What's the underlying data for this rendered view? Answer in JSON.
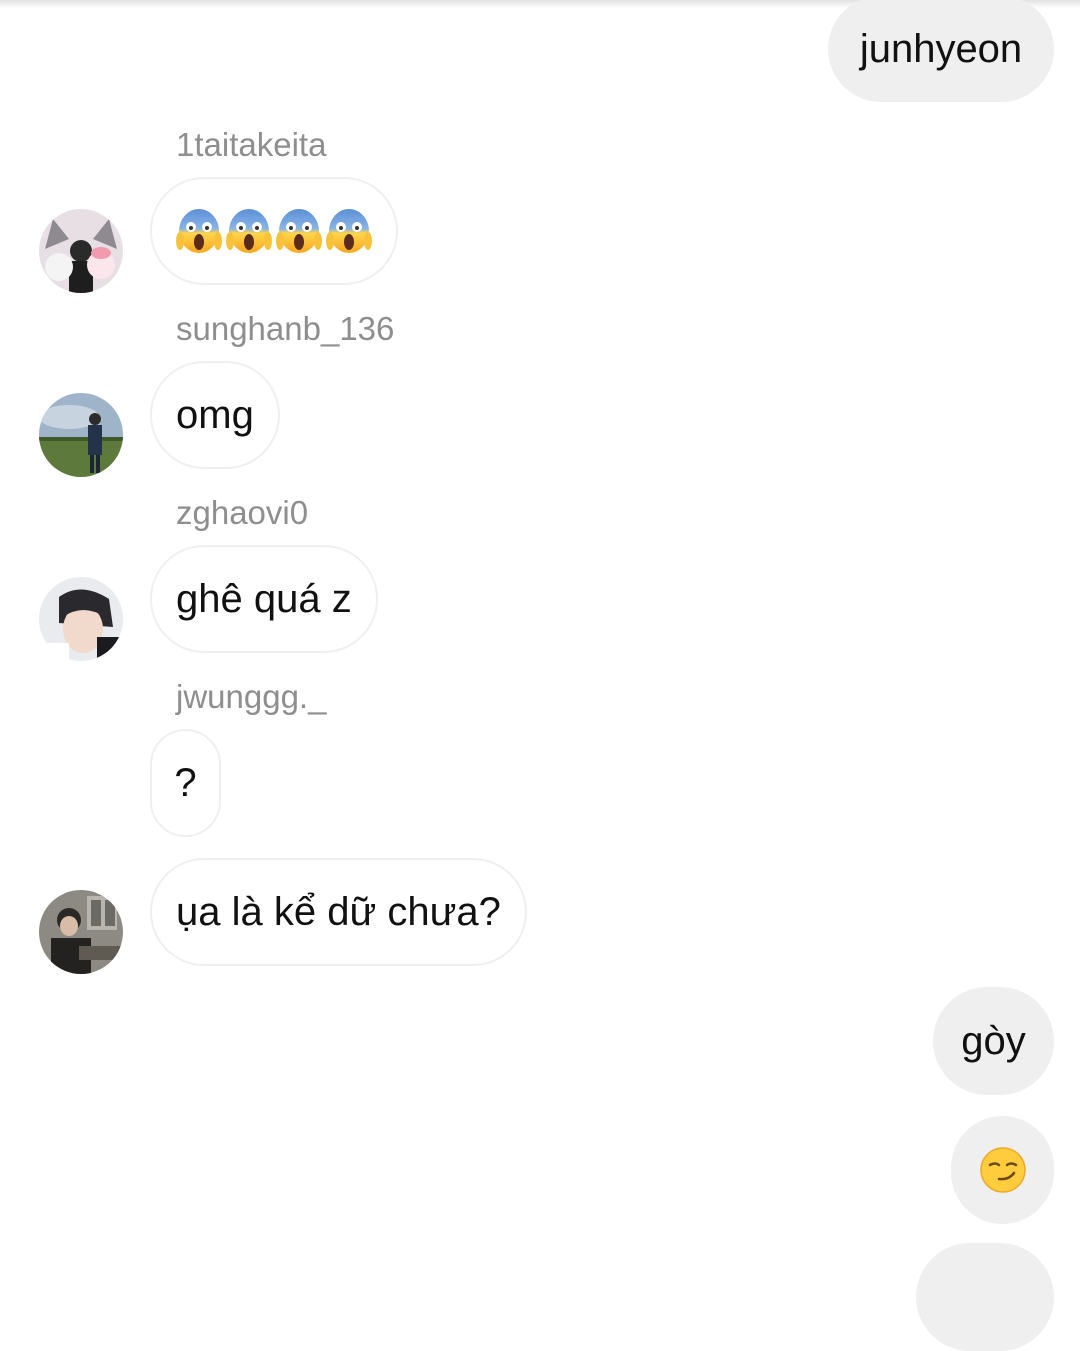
{
  "messages": [
    {
      "side": "out",
      "text": "junhyeon"
    },
    {
      "side": "in",
      "sender": "1taitakeita",
      "emoji": [
        "face-screaming-in-fear",
        "face-screaming-in-fear",
        "face-screaming-in-fear",
        "face-screaming-in-fear"
      ]
    },
    {
      "side": "in",
      "sender": "sunghanb_136",
      "text": "omg"
    },
    {
      "side": "in",
      "sender": "zghaovi0",
      "text": "ghê quá z"
    },
    {
      "side": "in",
      "sender": "jwunggg._",
      "text": "?"
    },
    {
      "side": "in",
      "text": "ụa là kể dữ chưa?"
    },
    {
      "side": "out",
      "text": "gòy"
    },
    {
      "side": "out",
      "emoji": [
        "smirking-face"
      ]
    }
  ],
  "colors": {
    "outgoing_bubble": "#efefef",
    "incoming_bubble_border": "#efefef",
    "sender_name": "#8e8e8e",
    "message_text": "#111111"
  }
}
